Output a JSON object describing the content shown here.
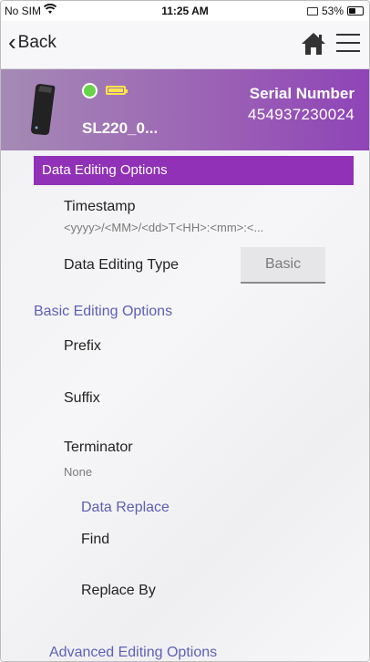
{
  "status_bar": {
    "carrier": "No SIM",
    "time": "11:25 AM",
    "battery_percent": "53%",
    "battery_level": 0.53,
    "icons": [
      "wifi-icon",
      "screen-mirror-icon",
      "battery-icon"
    ]
  },
  "nav": {
    "back_label": "Back",
    "icons": [
      "chevron-left-icon",
      "home-icon",
      "hamburger-menu-icon"
    ]
  },
  "device": {
    "name": "SL220_0...",
    "serial_label": "Serial Number",
    "serial_value": "454937230024",
    "connection_status_color": "#66d34a",
    "battery_color": "#ffe54a",
    "header_color": "#9c64b5"
  },
  "section": {
    "title": "Data Editing Options",
    "color": "#9031b7"
  },
  "timestamp": {
    "label": "Timestamp",
    "value": "<yyyy>/<MM>/<dd>T<HH>:<mm>:<..."
  },
  "data_editing_type": {
    "label": "Data Editing Type",
    "value": "Basic"
  },
  "basic_editing": {
    "title": "Basic Editing Options",
    "prefix_label": "Prefix",
    "suffix_label": "Suffix",
    "terminator_label": "Terminator",
    "terminator_value": "None"
  },
  "data_replace": {
    "title": "Data Replace",
    "find_label": "Find",
    "replace_label": "Replace By"
  },
  "advanced_editing": {
    "title": "Advanced Editing Options"
  }
}
